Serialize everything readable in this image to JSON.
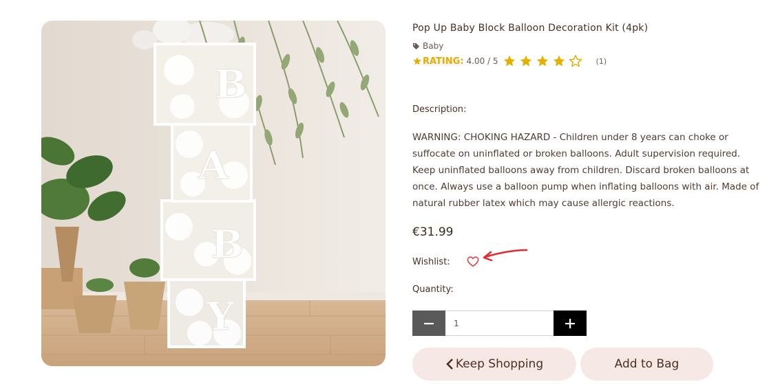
{
  "product": {
    "title": "Pop Up Baby Block Balloon Decoration Kit (4pk)",
    "category": "Baby",
    "rating_label": "RATING:",
    "rating_value": "4.00 / 5",
    "rating": 4,
    "rating_max": 5,
    "review_count": "(1)",
    "description_label": "Description:",
    "description": "WARNING: CHOKING HAZARD - Children under 8 years can choke or suffocate on uninflated or broken balloons. Adult supervision required. Keep uninflated balloons away from children. Discard broken balloons at once. Always use a balloon pump when inflating balloons with air. Made of natural rubber latex which may cause allergic reactions.",
    "price": "€31.99",
    "wishlist_label": "Wishlist:",
    "quantity_label": "Quantity:",
    "quantity_value": "1",
    "block_letters": [
      "B",
      "A",
      "B",
      "Y"
    ]
  },
  "buttons": {
    "minus_icon": "minus-icon",
    "plus_icon": "plus-icon",
    "keep_shopping": "Keep Shopping",
    "add_to_bag": "Add to Bag"
  },
  "colors": {
    "accent_star": "#e4b100",
    "heart": "#e0353b",
    "annotation_arrow": "#e8262b",
    "button_bg": "#f6e9e5",
    "title": "#4a2e22"
  }
}
